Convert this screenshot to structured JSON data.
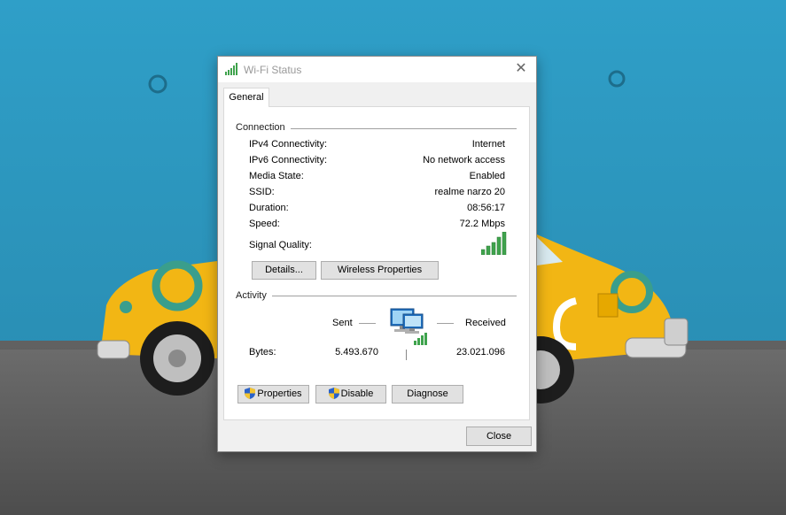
{
  "window": {
    "title": "Wi-Fi Status",
    "close_glyph": "✕"
  },
  "tabs": [
    {
      "label": "General"
    }
  ],
  "connection": {
    "heading": "Connection",
    "rows": [
      {
        "label": "IPv4 Connectivity:",
        "value": "Internet"
      },
      {
        "label": "IPv6 Connectivity:",
        "value": "No network access"
      },
      {
        "label": "Media State:",
        "value": "Enabled"
      },
      {
        "label": "SSID:",
        "value": "realme narzo 20"
      },
      {
        "label": "Duration:",
        "value": "08:56:17"
      },
      {
        "label": "Speed:",
        "value": "72.2 Mbps"
      }
    ],
    "signal_label": "Signal Quality:",
    "signal_bars": 5,
    "signal_bars_max": 5,
    "details_button": "Details...",
    "wireless_properties_button": "Wireless Properties"
  },
  "activity": {
    "heading": "Activity",
    "sent_label": "Sent",
    "received_label": "Received",
    "bytes_label": "Bytes:",
    "bytes_sent": "5.493.670",
    "bytes_received": "23.021.096",
    "properties_button": "Properties",
    "disable_button": "Disable",
    "diagnose_button": "Diagnose"
  },
  "footer": {
    "close_button": "Close"
  },
  "icons": {
    "title": "wifi-signal-icon",
    "signal": "signal-strength-icon",
    "network": "network-computers-icon",
    "shield": "uac-shield-icon"
  },
  "colors": {
    "signal_green": "#3fa34d",
    "wallpaper_blue": "#2c9cc4",
    "car_yellow": "#f2b614",
    "car_teal": "#3a9e8c",
    "floor_gray": "#5a5a5a"
  }
}
